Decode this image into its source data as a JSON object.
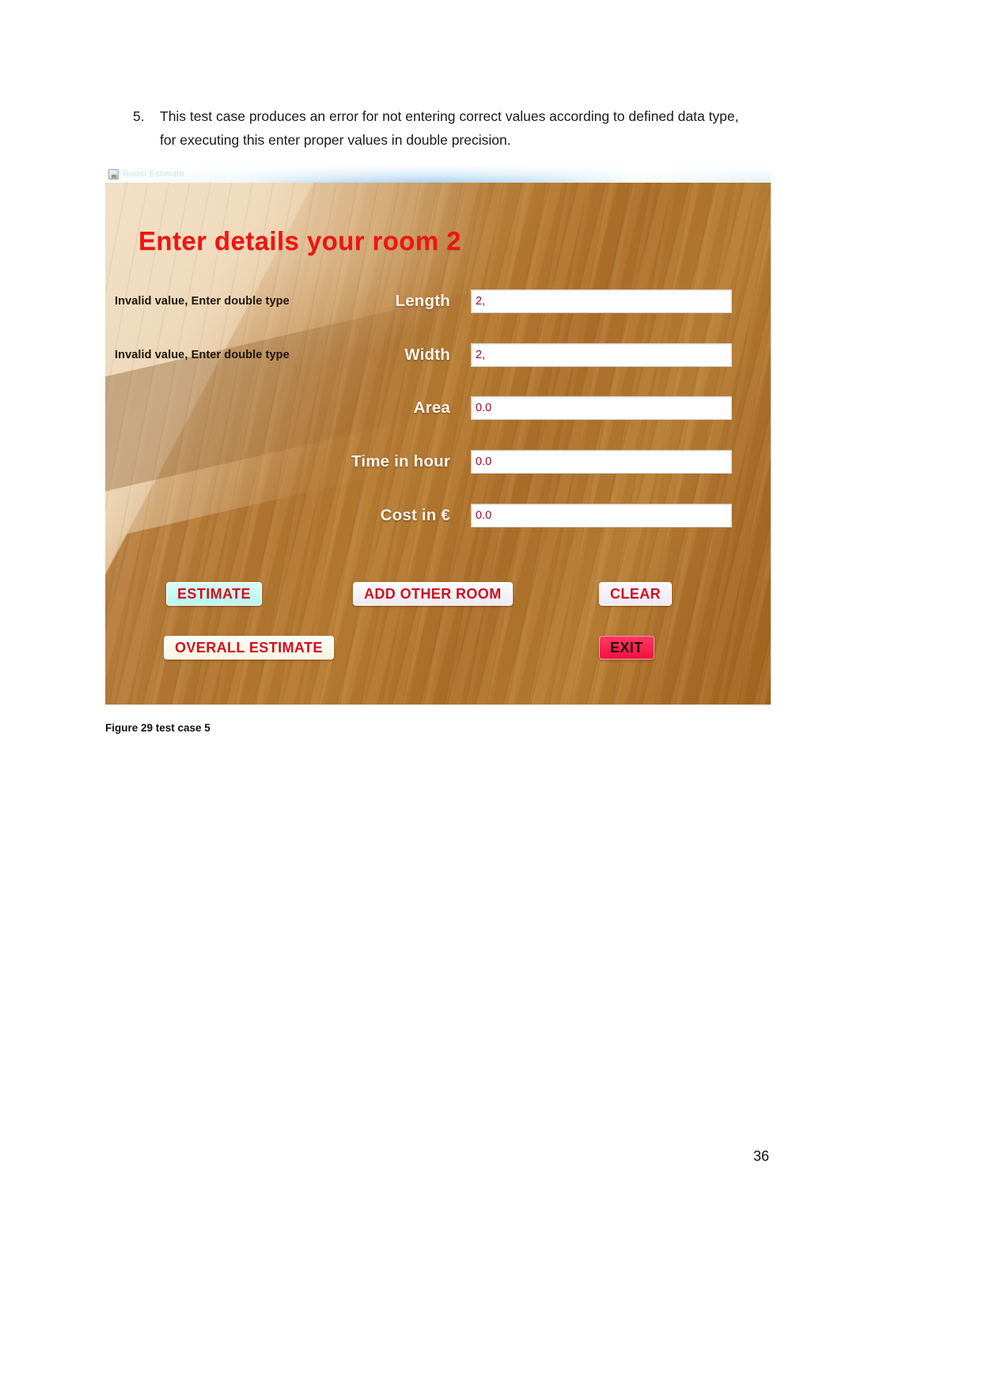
{
  "document": {
    "list_number": "5.",
    "paragraph": "This test case produces an error for not entering correct values according to defined data type, for executing this enter proper values in double precision.",
    "figure_caption": "Figure 29 test case 5",
    "page_number": "36"
  },
  "app_window": {
    "titlebar_title": "Room Estimate",
    "heading": "Enter details your room 2",
    "heading_color": "#ef1512",
    "fields": [
      {
        "error": "Invalid value, Enter double type",
        "label": "Length",
        "value": "2,"
      },
      {
        "error": "Invalid value, Enter double type",
        "label": "Width",
        "value": "2,"
      },
      {
        "error": "",
        "label": "Area",
        "value": "0.0"
      },
      {
        "error": "",
        "label": "Time in hour",
        "value": "0.0"
      },
      {
        "error": "",
        "label": "Cost in €",
        "value": "0.0"
      }
    ],
    "buttons": {
      "estimate": "ESTIMATE",
      "add_other_room": "ADD OTHER ROOM",
      "clear": "CLEAR",
      "overall_estimate": "OVERALL ESTIMATE",
      "exit": "EXIT"
    },
    "colors": {
      "estimate_bg": "#b9f6ef",
      "add_other_room_bg": "#eceaf3",
      "clear_bg": "#efe7f7",
      "overall_estimate_bg": "#fbf6e0",
      "exit_bg": "#f2103f",
      "button_text": "#cf1020",
      "field_value_text": "#9e0b2e",
      "field_label_text": "#fdf6ec",
      "error_text": "#201408"
    }
  }
}
